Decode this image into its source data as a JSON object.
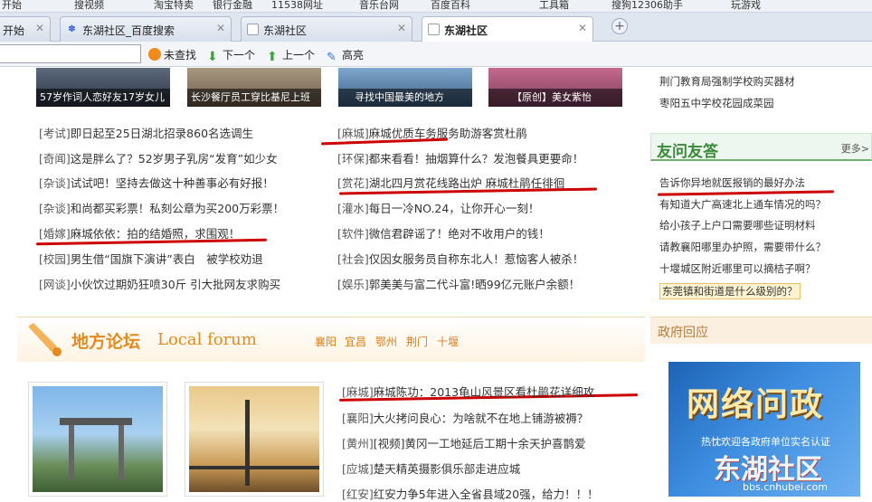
{
  "bookmarks": {
    "items": [
      "开始",
      "搜视频",
      "淘宝特卖",
      "银行金融",
      "11538网址",
      "音乐台网",
      "百度百科",
      "工具箱",
      "搜狗12306助手",
      "玩游戏"
    ]
  },
  "tabs": [
    {
      "label": "开始",
      "icon": "start-icon"
    },
    {
      "label": "东湖社区_百度搜索",
      "icon": "baidu-paw-icon"
    },
    {
      "label": "东湖社区",
      "icon": "page-icon"
    },
    {
      "label": "东湖社区",
      "icon": "page-icon",
      "active": true
    }
  ],
  "findbar": {
    "input_value": "",
    "not_found": "未查找",
    "next": "下一个",
    "prev": "上一个",
    "highlight": "高亮"
  },
  "thumbs": [
    {
      "caption": "57岁作词人恋好友17岁女儿"
    },
    {
      "caption": "长沙餐厅员工穿比基尼上班"
    },
    {
      "caption": "寻找中国最美的地方"
    },
    {
      "caption": "【原创】美女紫怡"
    }
  ],
  "news_left": [
    {
      "tag": "[考试]",
      "text": "即日起至25日湖北招录860名选调生"
    },
    {
      "tag": "[奇闻]",
      "text": "这是胖么了？52岁男子乳房“发育”如少女"
    },
    {
      "tag": "[杂谈]",
      "text": "试试吧！坚持去做这十种善事必有好报！"
    },
    {
      "tag": "[杂谈]",
      "text": "和尚都买彩票！私刻公章为买200万彩票！"
    },
    {
      "tag": "[婚嫁]",
      "text": "麻城依依：拍的结婚照，求围观！"
    },
    {
      "tag": "[校园]",
      "text": "男生借“国旗下演讲”表白　被学校劝退"
    },
    {
      "tag": "[网谈]",
      "text": "小伙饮过期奶狂喷30斤 引大批网友求购买"
    }
  ],
  "news_right": [
    {
      "tag": "[麻城]",
      "text": "麻城优质车务服务助游客赏杜鹃"
    },
    {
      "tag": "[环保]",
      "text": "都来看看！抽烟算什么？发泡餐具更要命！"
    },
    {
      "tag": "[赏花]",
      "text": "湖北四月赏花线路出炉 麻城杜鹃任徘徊"
    },
    {
      "tag": "[灌水]",
      "text": "每日一冷NO.24，让你开心一刻！"
    },
    {
      "tag": "[软件]",
      "text": "微信君辟谣了！绝对不收用户的钱！"
    },
    {
      "tag": "[社会]",
      "text": "仅因女服务员自称东北人！惹恼客人被杀！"
    },
    {
      "tag": "[娱乐]",
      "text": "郭美美与富二代斗富!晒99亿元账户余额！"
    }
  ],
  "side_top": [
    "荆门教育局强制学校购买器材",
    "枣阳五中学校花园成菜园"
  ],
  "qa": {
    "title": "友问友答",
    "more": "更多>",
    "items": [
      "告诉你异地就医报销的最好办法",
      "有知道大广高速北上通车情况的吗？",
      "给小孩子上户口需要哪些证明材料",
      "请教襄阳哪里办护照，需要带什么？",
      "十堰城区附近哪里可以摘桔子啊？",
      "东莞镇和街道是什么级别的？"
    ]
  },
  "forum": {
    "title_zh": "地方论坛",
    "title_en": "Local forum",
    "cities": [
      "襄阳",
      "宜昌",
      "鄂州",
      "荆门",
      "十堰"
    ],
    "posts": [
      {
        "tag": "[麻城]",
        "text": "麻城陈功：2013龟山风景区看杜鹃花详细攻"
      },
      {
        "tag": "[襄阳]",
        "text": "大火拷问良心：为啥就不在地上铺游被褥？"
      },
      {
        "tag": "[黄州]",
        "text": "[视频]黄冈一工地延后工期十余天护喜鹊爱"
      },
      {
        "tag": "[应城]",
        "text": "楚天精英摄影俱乐部走进应城"
      },
      {
        "tag": "[红安]",
        "text": "红安力争5年进入全省县域20强，给力！！！"
      }
    ]
  },
  "gov": {
    "title": "政府回应",
    "banner_title": "网络问政",
    "banner_sub": "热忱欢迎各政府单位实名认证",
    "watermark": "东湖社区",
    "watermark_url": "bbs.cnhubei.com"
  },
  "colors": {
    "annotation_red": "#cc0000",
    "accent_orange": "#e58a1f",
    "qa_green": "#3a8a3a"
  }
}
